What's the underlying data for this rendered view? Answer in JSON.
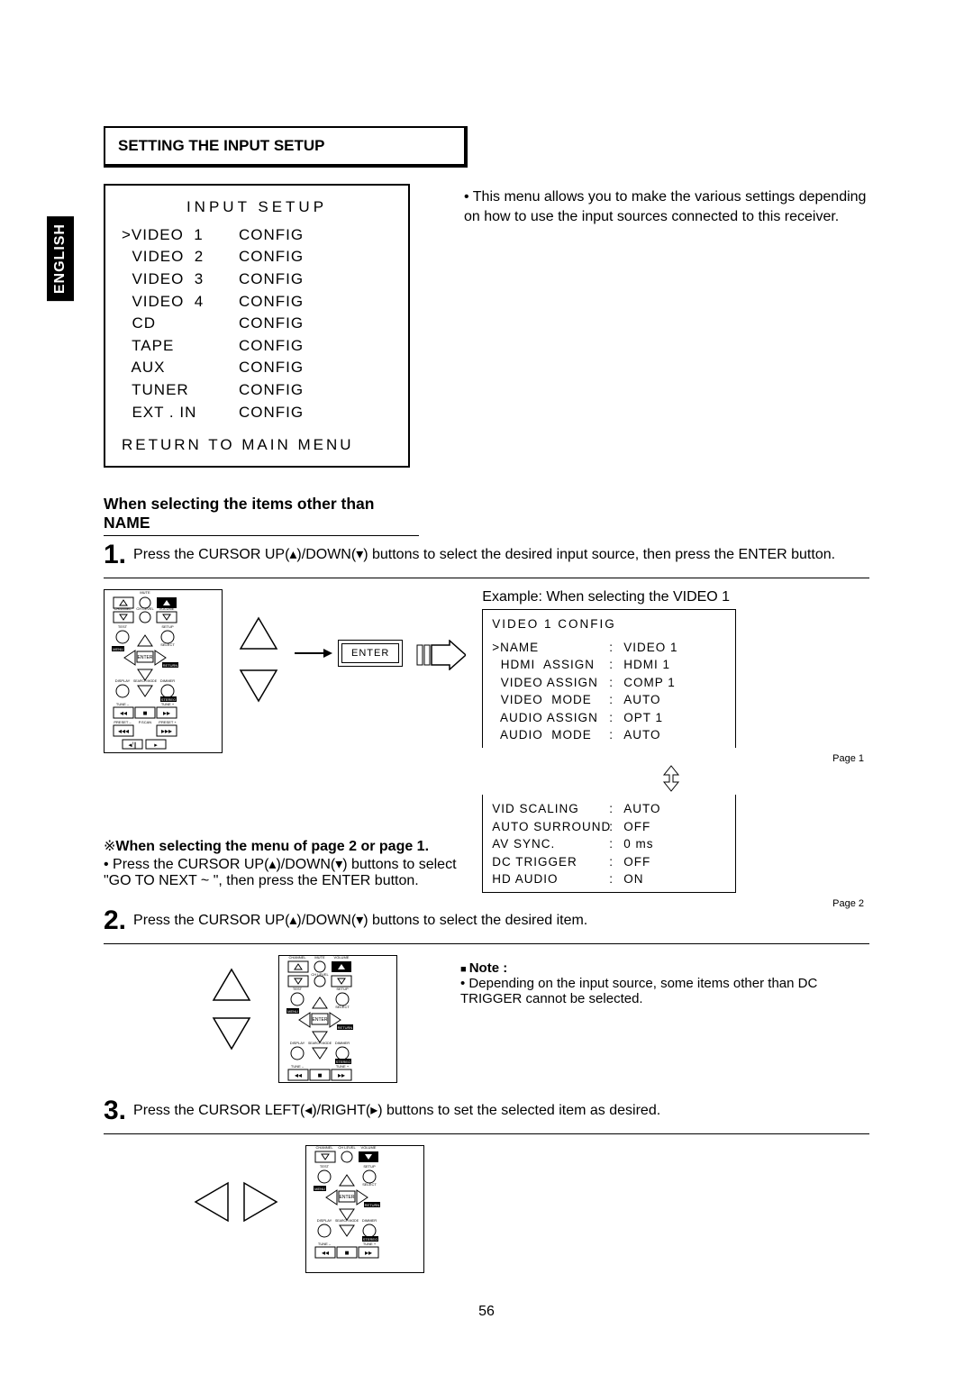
{
  "lang_tab": "ENGLISH",
  "section_title": "SETTING THE INPUT SETUP",
  "lcd_main": {
    "title": "INPUT  SETUP",
    "rows": [
      {
        "l": ">VIDEO  1",
        "r": "CONFIG"
      },
      {
        "l": "  VIDEO  2",
        "r": "CONFIG"
      },
      {
        "l": "  VIDEO  3",
        "r": "CONFIG"
      },
      {
        "l": "  VIDEO  4",
        "r": "CONFIG"
      },
      {
        "l": "  CD",
        "r": "CONFIG"
      },
      {
        "l": "  TAPE",
        "r": "CONFIG"
      },
      {
        "l": "  AUX",
        "r": "CONFIG"
      },
      {
        "l": "  TUNER",
        "r": "CONFIG"
      },
      {
        "l": "  EXT . IN",
        "r": "CONFIG"
      }
    ],
    "footer": "RETURN  TO  MAIN   MENU"
  },
  "top_desc": "This menu allows you to make the various settings depending on how to use the input sources connected to this receiver.",
  "subhead": "When selecting the items other than NAME",
  "step1_num": "1.",
  "step1_text": "Press the CURSOR UP(▴)/DOWN(▾) buttons to select the desired input source, then press the ENTER button.",
  "example_label": "Example: When selecting the VIDEO 1",
  "lcd_sub1": {
    "header": "VIDEO   1       CONFIG",
    "rows": [
      {
        "a": ">NAME",
        "c": ":",
        "b": "VIDEO   1"
      },
      {
        "a": "  HDMI  ASSIGN",
        "c": ":",
        "b": "HDMI   1"
      },
      {
        "a": "  VIDEO ASSIGN",
        "c": ":",
        "b": "COMP  1"
      },
      {
        "a": "  VIDEO  MODE",
        "c": ":",
        "b": "AUTO"
      },
      {
        "a": "  AUDIO ASSIGN",
        "c": ":",
        "b": "OPT   1"
      },
      {
        "a": "  AUDIO  MODE",
        "c": ":",
        "b": "AUTO"
      }
    ],
    "page": "Page 1"
  },
  "lcd_sub2": {
    "rows": [
      {
        "a": "VID SCALING",
        "c": ":",
        "b": "AUTO"
      },
      {
        "a": "AUTO SURROUND",
        "c": ":",
        "b": "OFF"
      },
      {
        "a": "AV SYNC.",
        "c": ":",
        "b": "0  ms"
      },
      {
        "a": "DC TRIGGER",
        "c": ":",
        "b": "OFF"
      },
      {
        "a": "HD AUDIO",
        "c": ":",
        "b": "ON"
      }
    ],
    "page": "Page 2"
  },
  "menu_select_bold": "When selecting the menu of page 2 or page 1.",
  "menu_select_text": "Press the CURSOR UP(▴)/DOWN(▾) buttons to select \"GO TO NEXT ~ \", then press the ENTER button.",
  "menu_select_prefix": "※",
  "enter_label": "ENTER",
  "step2_num": "2.",
  "step2_text": "Press the CURSOR UP(▴)/DOWN(▾) buttons to select the desired item.",
  "note_hd": "Note :",
  "note_body": "Depending on the input source, some items other than DC TRIGGER cannot be selected.",
  "step3_num": "3.",
  "step3_text": "Press the CURSOR LEFT(◂)/RIGHT(▸) buttons to set the selected item as desired.",
  "page_number": "56"
}
